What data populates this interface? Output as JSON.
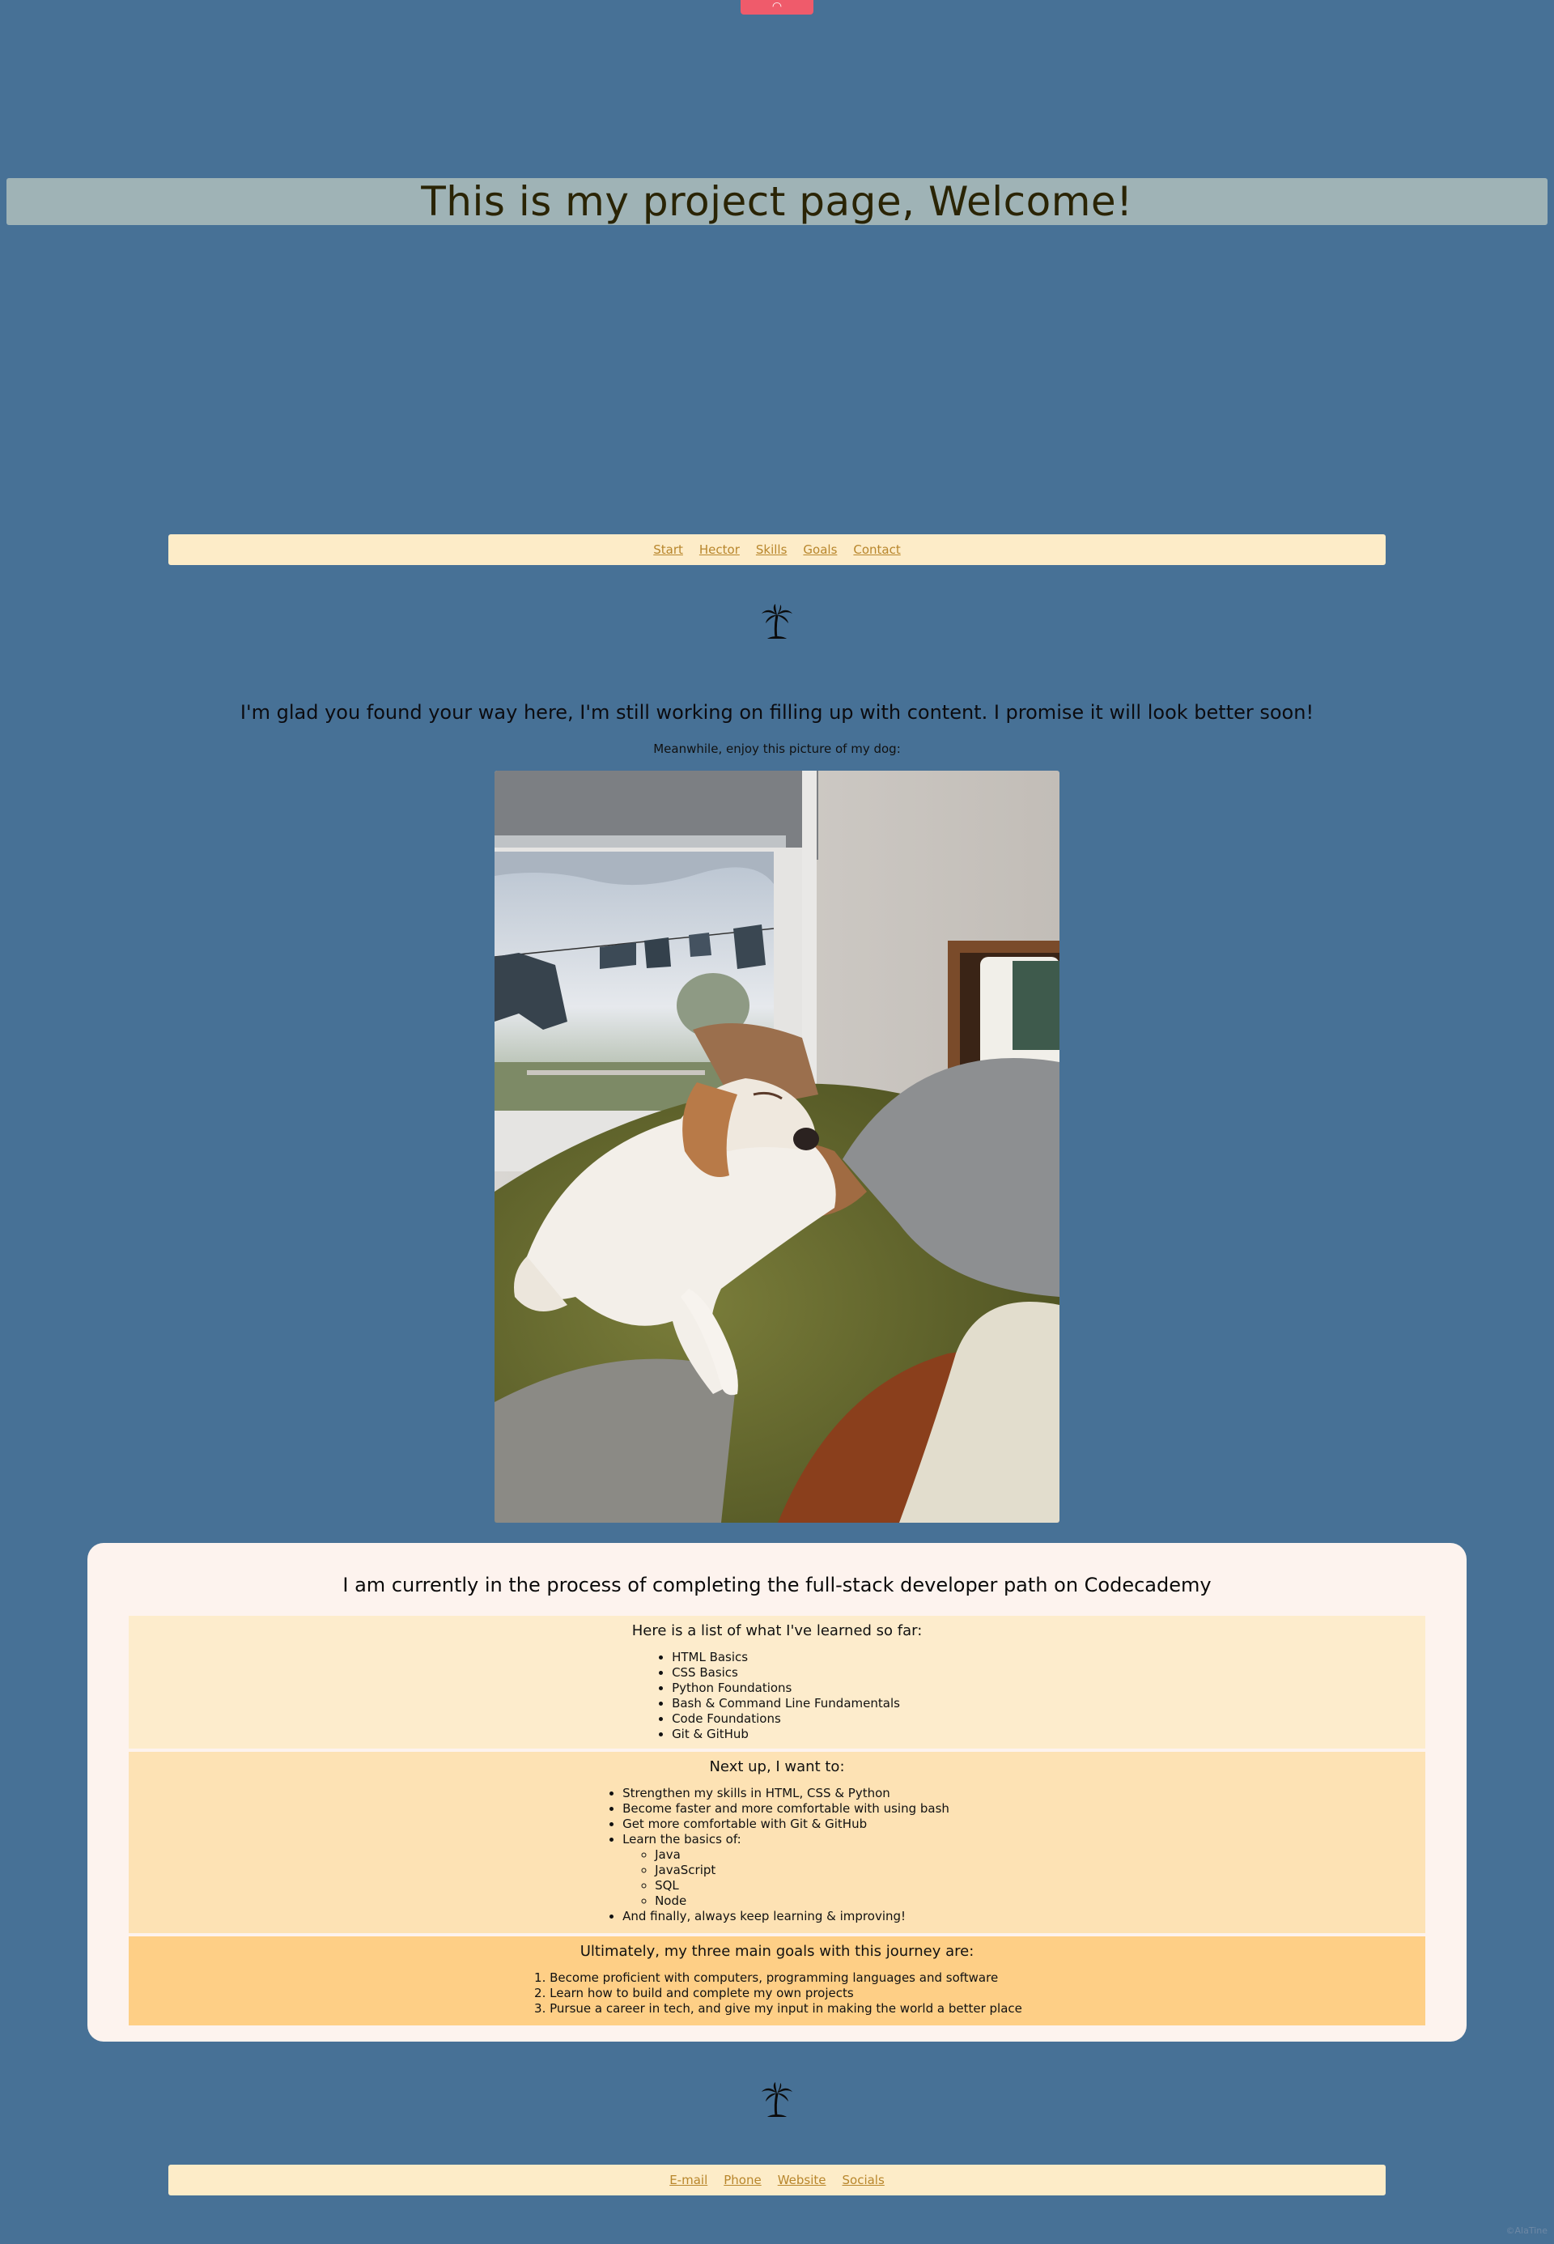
{
  "header": {
    "top_tab_icon": "arch-icon",
    "title": "This is my project page, Welcome!"
  },
  "nav": {
    "items": [
      "Start",
      "Hector",
      "Skills",
      "Goals",
      "Contact"
    ]
  },
  "intro": {
    "heading": "I'm glad you found your way here, I'm still working on filling up with content. I promise it will look better soon!",
    "text": "Meanwhile, enjoy this picture of my dog:"
  },
  "skills": {
    "title": "I am currently in the process of completing the full-stack developer path on Codecademy",
    "learned_heading": "Here is a list of what I've learned so far:",
    "learned": [
      "HTML Basics",
      "CSS Basics",
      "Python Foundations",
      "Bash & Command Line Fundamentals",
      "Code Foundations",
      "Git & GitHub"
    ],
    "next_heading": "Next up, I want to:",
    "next": [
      "Strengthen my skills in HTML, CSS & Python",
      "Become faster and more comfortable with using bash",
      "Get more comfortable with Git & GitHub",
      "Learn the basics of:"
    ],
    "next_sub": [
      "Java",
      "JavaScript",
      "SQL",
      "Node"
    ],
    "next_last": "And finally, always keep learning & improving!",
    "goals_heading": "Ultimately, my three main goals with this journey are:",
    "goals": [
      "Become proficient with computers, programming languages and software",
      "Learn how to build and complete my own projects",
      "Pursue a career in tech, and give my input in making the world a better place"
    ]
  },
  "footer_nav": {
    "items": [
      "E-mail",
      "Phone",
      "Website",
      "Socials"
    ]
  },
  "watermark": "©AlaTine",
  "colors": {
    "background": "#477196",
    "title_bar": "#9fb3b6",
    "nav_bar": "#fdecc8",
    "link": "#b8862c",
    "accent_tab": "#ef5b6b"
  }
}
